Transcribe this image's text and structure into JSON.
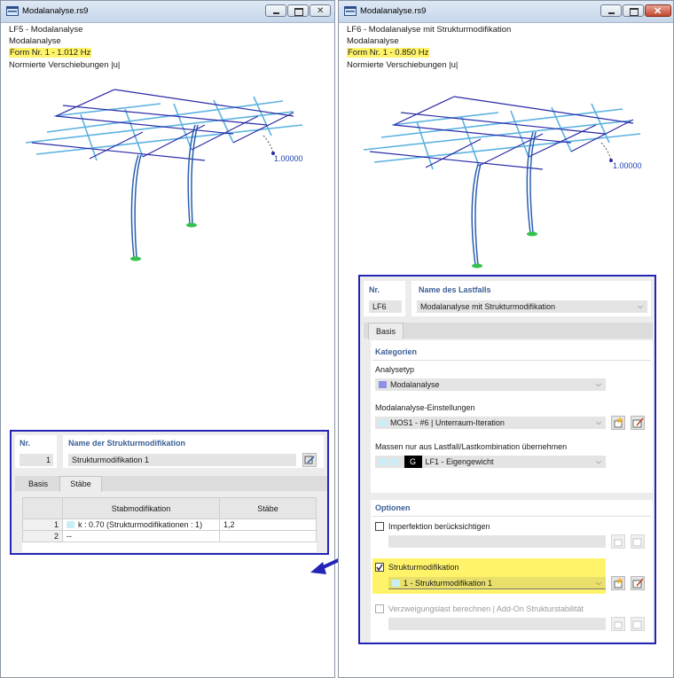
{
  "left_window": {
    "title": "Modalanalyse.rs9",
    "info": [
      "LF5 - Modalanalyse",
      "Modalanalyse",
      "Form Nr. 1 - 1.012 Hz",
      "Normierte Verschiebungen |u|"
    ],
    "value_label": "1.00000",
    "panel": {
      "nr_label": "Nr.",
      "nr_value": "1",
      "name_label": "Name der Strukturmodifikation",
      "name_value": "Strukturmodifikation 1",
      "tabs": [
        "Basis",
        "Stäbe"
      ],
      "table": {
        "headers": [
          "Stabmodifikation",
          "Stäbe"
        ],
        "rows": [
          {
            "no": "1",
            "mod": "k : 0.70 (Strukturmodifikationen : 1)",
            "members": "1,2"
          },
          {
            "no": "2",
            "mod": "--",
            "members": ""
          }
        ]
      }
    }
  },
  "right_window": {
    "title": "Modalanalyse.rs9",
    "info": [
      "LF6 - Modalanalyse mit Strukturmodifikation",
      "Modalanalyse",
      "Form Nr. 1 - 0.850 Hz",
      "Normierte Verschiebungen |u|"
    ],
    "value_label": "1.00000",
    "panel": {
      "nr_label": "Nr.",
      "nr_value": "LF6",
      "name_label": "Name des Lastfalls",
      "name_value": "Modalanalyse mit Strukturmodifikation",
      "tab": "Basis",
      "kategorien": "Kategorien",
      "analysetyp_label": "Analysetyp",
      "analysetyp_value": "Modalanalyse",
      "modal_settings_label": "Modalanalyse-Einstellungen",
      "modal_settings_value": "MOS1 - #6 | Unterraum-Iteration",
      "masses_label": "Massen nur aus Lastfall/Lastkombination übernehmen",
      "masses_badge": "G",
      "masses_value": "LF1 - Eigengewicht",
      "optionen": "Optionen",
      "imperfektion": "Imperfektion berücksichtigen",
      "strukturmod": "Strukturmodifikation",
      "strukturmod_value": "1 - Strukturmodifikation 1",
      "verzweigung": "Verzweigungslast berechnen | Add-On Strukturstabilität"
    }
  },
  "colors": {
    "panel_border": "#2424b8",
    "highlight": "#fff36a",
    "frame_dark": "#2a2aa8",
    "frame_light": "#5cb2e0",
    "support": "#35c24a",
    "swatch_modal": "#8f8fe6",
    "swatch_mos": "#c8eef6"
  }
}
